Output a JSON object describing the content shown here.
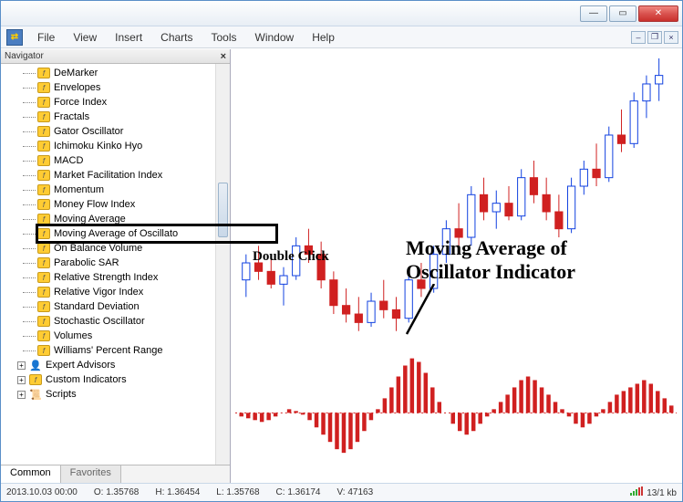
{
  "menu": [
    "File",
    "View",
    "Insert",
    "Charts",
    "Tools",
    "Window",
    "Help"
  ],
  "navigator": {
    "title": "Navigator",
    "indicators": [
      "DeMarker",
      "Envelopes",
      "Force Index",
      "Fractals",
      "Gator Oscillator",
      "Ichimoku Kinko Hyo",
      "MACD",
      "Market Facilitation Index",
      "Momentum",
      "Money Flow Index",
      "Moving Average",
      "Moving Average of Oscillato",
      "On Balance Volume",
      "Parabolic SAR",
      "Relative Strength Index",
      "Relative Vigor Index",
      "Standard Deviation",
      "Stochastic Oscillator",
      "Volumes",
      "Williams' Percent Range"
    ],
    "highlight_index": 11,
    "categories": [
      {
        "label": "Expert Advisors",
        "icon": "👤"
      },
      {
        "label": "Custom Indicators",
        "icon": "f"
      },
      {
        "label": "Scripts",
        "icon": "📜"
      }
    ],
    "tabs": [
      "Common",
      "Favorites"
    ]
  },
  "annotations": {
    "double_click": "Double Click",
    "indicator_title": "Moving Average of\nOscillator Indicator"
  },
  "status": {
    "date": "2013.10.03 00:00",
    "o": "O: 1.35768",
    "h": "H: 1.36454",
    "l": "L: 1.35768",
    "c": "C: 1.36174",
    "v": "V: 47163",
    "conn": "13/1 kb"
  },
  "chart_data": {
    "type": "candlestick+histogram",
    "title": "",
    "candles_note": "approximate OHLC candle series — blue=bull, red=bear",
    "candles": [
      {
        "o": 12,
        "h": 18,
        "l": 8,
        "c": 16,
        "color": "blue"
      },
      {
        "o": 16,
        "h": 20,
        "l": 12,
        "c": 14,
        "color": "red"
      },
      {
        "o": 14,
        "h": 17,
        "l": 10,
        "c": 11,
        "color": "red"
      },
      {
        "o": 11,
        "h": 15,
        "l": 6,
        "c": 13,
        "color": "blue"
      },
      {
        "o": 13,
        "h": 22,
        "l": 12,
        "c": 20,
        "color": "blue"
      },
      {
        "o": 20,
        "h": 24,
        "l": 16,
        "c": 18,
        "color": "red"
      },
      {
        "o": 18,
        "h": 21,
        "l": 10,
        "c": 12,
        "color": "red"
      },
      {
        "o": 12,
        "h": 14,
        "l": 4,
        "c": 6,
        "color": "red"
      },
      {
        "o": 6,
        "h": 10,
        "l": 2,
        "c": 4,
        "color": "red"
      },
      {
        "o": 4,
        "h": 8,
        "l": 0,
        "c": 2,
        "color": "red"
      },
      {
        "o": 2,
        "h": 9,
        "l": 1,
        "c": 7,
        "color": "blue"
      },
      {
        "o": 7,
        "h": 12,
        "l": 3,
        "c": 5,
        "color": "red"
      },
      {
        "o": 5,
        "h": 8,
        "l": 0,
        "c": 3,
        "color": "red"
      },
      {
        "o": 3,
        "h": 14,
        "l": 2,
        "c": 12,
        "color": "blue"
      },
      {
        "o": 12,
        "h": 16,
        "l": 8,
        "c": 10,
        "color": "red"
      },
      {
        "o": 10,
        "h": 20,
        "l": 9,
        "c": 18,
        "color": "blue"
      },
      {
        "o": 18,
        "h": 26,
        "l": 16,
        "c": 24,
        "color": "blue"
      },
      {
        "o": 24,
        "h": 30,
        "l": 20,
        "c": 22,
        "color": "red"
      },
      {
        "o": 22,
        "h": 34,
        "l": 20,
        "c": 32,
        "color": "blue"
      },
      {
        "o": 32,
        "h": 36,
        "l": 26,
        "c": 28,
        "color": "red"
      },
      {
        "o": 28,
        "h": 33,
        "l": 24,
        "c": 30,
        "color": "blue"
      },
      {
        "o": 30,
        "h": 34,
        "l": 26,
        "c": 27,
        "color": "red"
      },
      {
        "o": 27,
        "h": 38,
        "l": 26,
        "c": 36,
        "color": "blue"
      },
      {
        "o": 36,
        "h": 40,
        "l": 30,
        "c": 32,
        "color": "red"
      },
      {
        "o": 32,
        "h": 36,
        "l": 26,
        "c": 28,
        "color": "red"
      },
      {
        "o": 28,
        "h": 32,
        "l": 22,
        "c": 24,
        "color": "red"
      },
      {
        "o": 24,
        "h": 36,
        "l": 23,
        "c": 34,
        "color": "blue"
      },
      {
        "o": 34,
        "h": 40,
        "l": 32,
        "c": 38,
        "color": "blue"
      },
      {
        "o": 38,
        "h": 44,
        "l": 34,
        "c": 36,
        "color": "red"
      },
      {
        "o": 36,
        "h": 48,
        "l": 35,
        "c": 46,
        "color": "blue"
      },
      {
        "o": 46,
        "h": 52,
        "l": 42,
        "c": 44,
        "color": "red"
      },
      {
        "o": 44,
        "h": 56,
        "l": 43,
        "c": 54,
        "color": "blue"
      },
      {
        "o": 54,
        "h": 60,
        "l": 50,
        "c": 58,
        "color": "blue"
      },
      {
        "o": 58,
        "h": 64,
        "l": 54,
        "c": 60,
        "color": "blue"
      }
    ],
    "oscillator_note": "OSMA histogram values approx",
    "oscillator": [
      -2,
      -3,
      -4,
      -5,
      -4,
      -2,
      0,
      2,
      1,
      -1,
      -4,
      -8,
      -12,
      -16,
      -20,
      -22,
      -20,
      -16,
      -10,
      -4,
      2,
      8,
      14,
      20,
      26,
      30,
      28,
      22,
      14,
      6,
      0,
      -6,
      -10,
      -12,
      -10,
      -6,
      -2,
      2,
      6,
      10,
      14,
      18,
      20,
      18,
      14,
      10,
      6,
      2,
      -2,
      -6,
      -8,
      -6,
      -2,
      2,
      6,
      10,
      12,
      14,
      16,
      18,
      16,
      12,
      8,
      4
    ]
  }
}
